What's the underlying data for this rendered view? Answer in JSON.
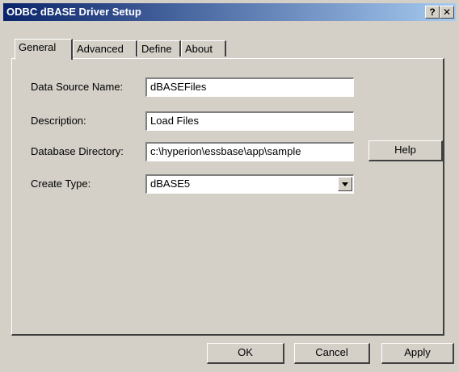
{
  "window": {
    "title": "ODBC dBASE Driver Setup",
    "help_glyph": "?",
    "close_glyph": "✕"
  },
  "tabs": [
    {
      "label": "General",
      "active": true
    },
    {
      "label": "Advanced",
      "active": false
    },
    {
      "label": "Define",
      "active": false
    },
    {
      "label": "About",
      "active": false
    }
  ],
  "form": {
    "data_source_name": {
      "label": "Data Source Name:",
      "value": "dBASEFiles"
    },
    "description": {
      "label": "Description:",
      "value": "Load Files"
    },
    "database_directory": {
      "label": "Database Directory:",
      "value": "c:\\hyperion\\essbase\\app\\sample"
    },
    "create_type": {
      "label": "Create Type:",
      "value": "dBASE5"
    }
  },
  "buttons": {
    "help": "Help",
    "ok": "OK",
    "cancel": "Cancel",
    "apply": "Apply"
  }
}
